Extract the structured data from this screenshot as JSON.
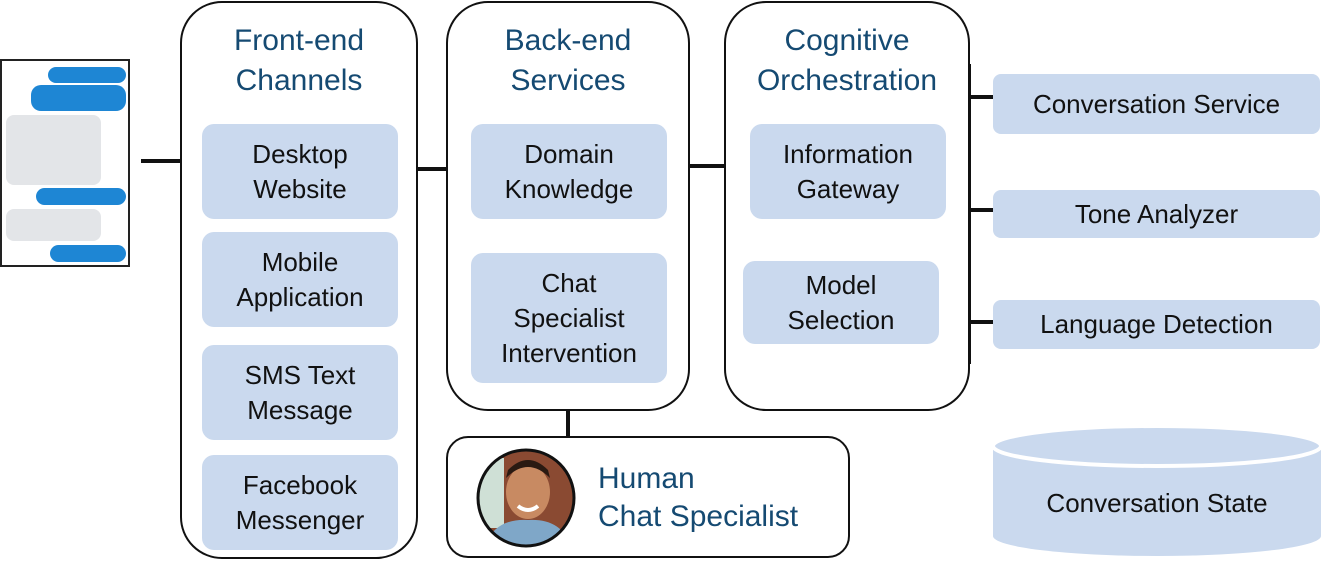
{
  "phone_mockup": {
    "icon": "chat-conversation-icon",
    "bubbles": [
      {
        "side": "right",
        "color": "#1e86d4"
      },
      {
        "side": "right",
        "color": "#1e86d4"
      },
      {
        "side": "left",
        "color": "#e3e5e8"
      },
      {
        "side": "right",
        "color": "#1e86d4"
      },
      {
        "side": "left",
        "color": "#e3e5e8"
      },
      {
        "side": "right",
        "color": "#1e86d4"
      }
    ]
  },
  "groups": {
    "frontend": {
      "title": "Front-end\nChannels",
      "items": [
        "Desktop\nWebsite",
        "Mobile\nApplication",
        "SMS Text\nMessage",
        "Facebook\nMessenger"
      ]
    },
    "backend": {
      "title": "Back-end\nServices",
      "items": [
        "Domain\nKnowledge",
        "Chat\nSpecialist\nIntervention"
      ]
    },
    "cognitive": {
      "title": "Cognitive\nOrchestration",
      "items": [
        "Information\nGateway",
        "Model\nSelection"
      ]
    }
  },
  "human": {
    "title": "Human\nChat Specialist",
    "avatar_icon": "person-photo-icon"
  },
  "services": [
    "Conversation Service",
    "Tone Analyzer",
    "Language Detection"
  ],
  "datastore": {
    "label": "Conversation State",
    "icon": "database-cylinder-icon"
  },
  "colors": {
    "title_text": "#154a72",
    "node_fill": "#cad9ee",
    "line": "#111111",
    "bubble_blue": "#1e86d4",
    "bubble_gray": "#e3e5e8"
  }
}
